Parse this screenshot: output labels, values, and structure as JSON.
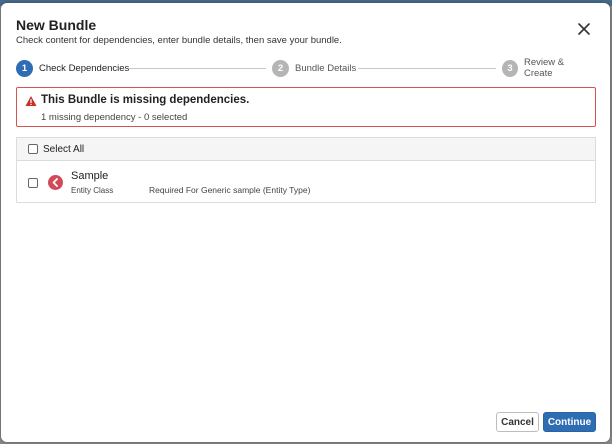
{
  "modal": {
    "title": "New Bundle",
    "subtitle": "Check content for dependencies, enter bundle details, then save your bundle.",
    "close_icon": "close-icon"
  },
  "stepper": {
    "steps": [
      {
        "number": "1",
        "label": "Check Dependencies",
        "active": true
      },
      {
        "number": "2",
        "label": "Bundle Details",
        "active": false
      },
      {
        "number": "3",
        "label": "Review & Create",
        "active": false
      }
    ]
  },
  "alert": {
    "icon": "warning-icon",
    "title": "This Bundle is missing dependencies.",
    "text": "1 missing dependency - 0 selected",
    "color": "#d9534f"
  },
  "list": {
    "select_all_label": "Select All",
    "items": [
      {
        "name": "Sample",
        "type": "Entity Class",
        "description": "Required For Generic sample (Entity Type)",
        "icon": "entity-class-icon"
      }
    ]
  },
  "footer": {
    "cancel_label": "Cancel",
    "continue_label": "Continue"
  },
  "colors": {
    "accent": "#2e6db4",
    "alert_border": "#d9534f",
    "entity_icon": "#d04a58"
  }
}
